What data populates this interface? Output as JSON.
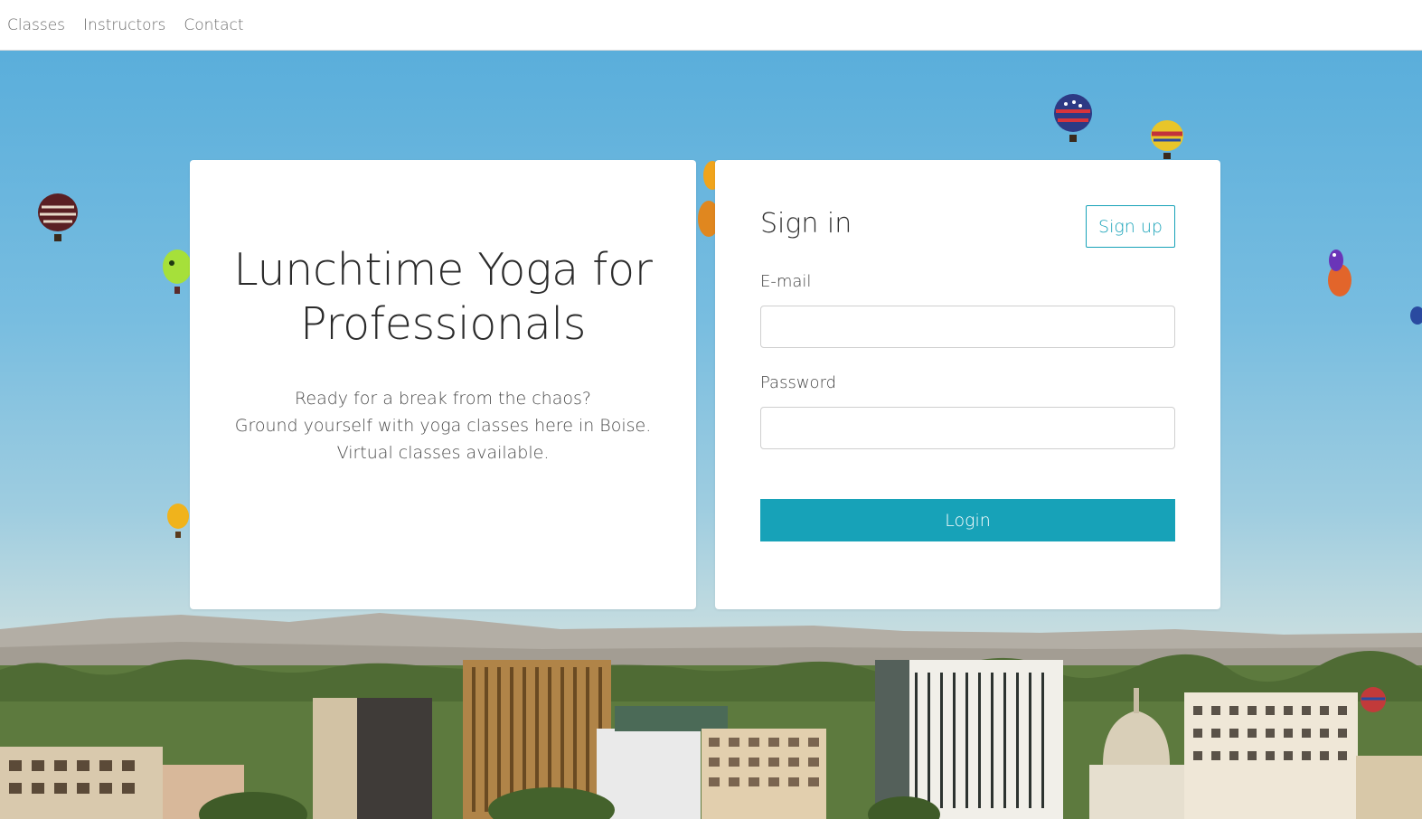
{
  "nav": {
    "items": [
      {
        "label": "Classes"
      },
      {
        "label": "Instructors"
      },
      {
        "label": "Contact"
      }
    ]
  },
  "intro": {
    "title": "Lunchtime Yoga for Professionals",
    "lines": [
      "Ready for a break from the chaos?",
      "Ground yourself with yoga classes here in Boise.",
      "Virtual classes available."
    ]
  },
  "signin": {
    "title": "Sign in",
    "signup_label": "Sign up",
    "email_label": "E-mail",
    "email_value": "",
    "password_label": "Password",
    "password_value": "",
    "login_label": "Login"
  },
  "colors": {
    "accent": "#17a2b8",
    "sky_top": "#5aaedb",
    "text_dark": "#2b2b2b"
  },
  "background": {
    "description_icon": "hot-air-balloons-over-city-skyline-image"
  }
}
